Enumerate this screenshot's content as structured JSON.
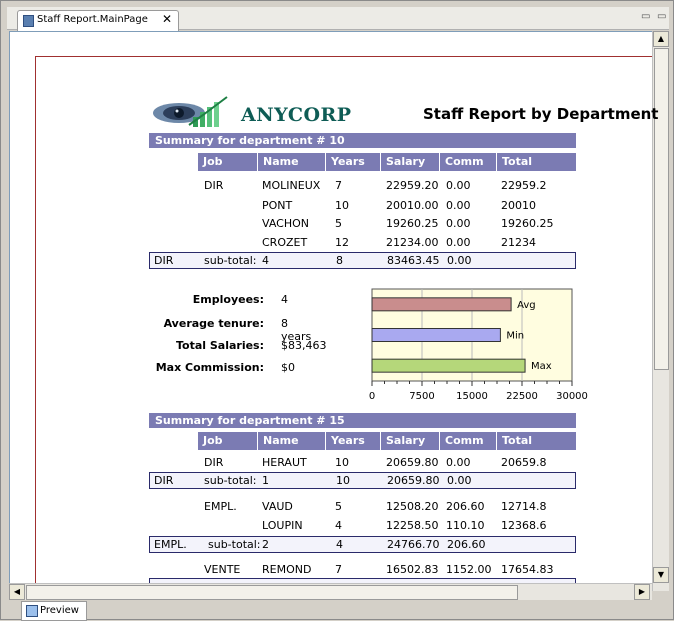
{
  "tab": {
    "title": "Staff Report.MainPage",
    "close": "✕"
  },
  "window_controls": {
    "minimize": "▭",
    "maximize": "▭"
  },
  "bottom_tab": {
    "label": "Preview"
  },
  "report": {
    "logo_text": "ANYCORP",
    "title": "Staff Report by Department",
    "columns": [
      "Job",
      "Name",
      "Years",
      "Salary",
      "Comm",
      "Total"
    ],
    "dept10": {
      "summary": "Summary for department # 10",
      "rows": [
        {
          "job": "DIR",
          "name": "MOLINEUX",
          "years": "7",
          "salary": "22959.20",
          "comm": "0.00",
          "total": "22959.2"
        },
        {
          "job": "",
          "name": "PONT",
          "years": "10",
          "salary": "20010.00",
          "comm": "0.00",
          "total": "20010"
        },
        {
          "job": "",
          "name": "VACHON",
          "years": "5",
          "salary": "19260.25",
          "comm": "0.00",
          "total": "19260.25"
        },
        {
          "job": "",
          "name": "CROZET",
          "years": "12",
          "salary": "21234.00",
          "comm": "0.00",
          "total": "21234"
        }
      ],
      "subtotal": {
        "job": "DIR",
        "label": "sub-total:",
        "count": "4",
        "years": "8",
        "salary": "83463.45",
        "comm": "0.00"
      },
      "stats": [
        {
          "label": "Employees:",
          "value": "4"
        },
        {
          "label": "Average tenure:",
          "value": "8 years"
        },
        {
          "label": "Total Salaries:",
          "value": "$83,463"
        },
        {
          "label": "Max Commission:",
          "value": "$0"
        }
      ]
    },
    "dept15": {
      "summary": "Summary for department # 15",
      "group1": {
        "rows": [
          {
            "job": "DIR",
            "name": "HERAUT",
            "years": "10",
            "salary": "20659.80",
            "comm": "0.00",
            "total": "20659.8"
          }
        ],
        "subtotal": {
          "job": "DIR",
          "label": "sub-total:",
          "count": "1",
          "years": "10",
          "salary": "20659.80",
          "comm": "0.00"
        }
      },
      "group2": {
        "rows": [
          {
            "job": "EMPL.",
            "name": "VAUD",
            "years": "5",
            "salary": "12508.20",
            "comm": "206.60",
            "total": "12714.8"
          },
          {
            "job": "",
            "name": "LOUPIN",
            "years": "4",
            "salary": "12258.50",
            "comm": "110.10",
            "total": "12368.6"
          }
        ],
        "subtotal": {
          "job": "EMPL.",
          "label": "sub-total:",
          "count": "2",
          "years": "4",
          "salary": "24766.70",
          "comm": "206.60"
        }
      },
      "group3": {
        "rows": [
          {
            "job": "VENTE",
            "name": "REMOND",
            "years": "7",
            "salary": "16502.83",
            "comm": "1152.00",
            "total": "17654.83"
          }
        ]
      }
    }
  },
  "chart_data": {
    "type": "bar",
    "orientation": "horizontal",
    "categories": [
      "Avg",
      "Min",
      "Max"
    ],
    "values": [
      20866,
      19260,
      22959
    ],
    "colors": [
      "#c98d8d",
      "#a9a9f0",
      "#b5d77a"
    ],
    "xlim": [
      0,
      30000
    ],
    "xticks": [
      "0",
      "7500",
      "15000",
      "22500",
      "30000"
    ],
    "background": "#fffde0",
    "grid": true
  }
}
